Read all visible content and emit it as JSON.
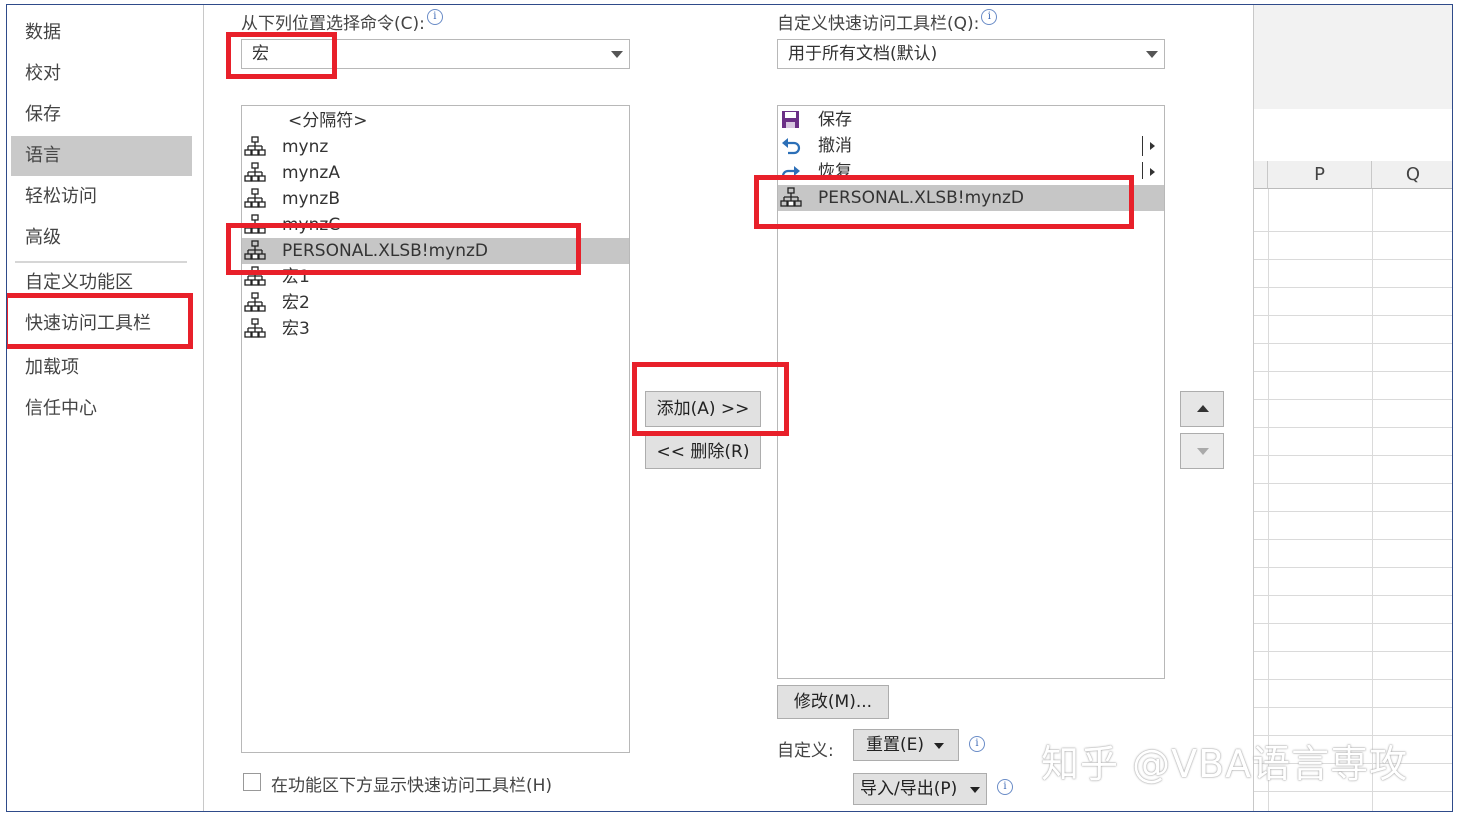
{
  "nav": {
    "items": [
      {
        "label": "数据"
      },
      {
        "label": "校对"
      },
      {
        "label": "保存"
      },
      {
        "label": "语言"
      },
      {
        "label": "轻松访问"
      },
      {
        "label": "高级"
      },
      {
        "label": "自定义功能区"
      },
      {
        "label": "快速访问工具栏"
      },
      {
        "label": "加载项"
      },
      {
        "label": "信任中心"
      }
    ],
    "selected": "语言"
  },
  "left_panel": {
    "choose_label": "从下列位置选择命令(C):",
    "choose_value": "宏",
    "items": [
      {
        "label": "<分隔符>",
        "icon": "separator"
      },
      {
        "label": "mynz",
        "icon": "macro-icon"
      },
      {
        "label": "mynzA",
        "icon": "macro-icon"
      },
      {
        "label": "mynzB",
        "icon": "macro-icon"
      },
      {
        "label": "mynzC",
        "icon": "macro-icon"
      },
      {
        "label": "PERSONAL.XLSB!mynzD",
        "icon": "macro-icon"
      },
      {
        "label": "宏1",
        "icon": "macro-icon"
      },
      {
        "label": "宏2",
        "icon": "macro-icon"
      },
      {
        "label": "宏3",
        "icon": "macro-icon"
      }
    ],
    "selected_item": "PERSONAL.XLSB!mynzD",
    "show_below_label": "在功能区下方显示快速访问工具栏(H)"
  },
  "middle": {
    "add_label": "添加(A) >>",
    "remove_label": "<< 删除(R)"
  },
  "right_panel": {
    "customize_label": "自定义快速访问工具栏(Q):",
    "customize_value": "用于所有文档(默认)",
    "items": [
      {
        "label": "保存",
        "icon": "save-icon"
      },
      {
        "label": "撤消",
        "icon": "undo-icon"
      },
      {
        "label": "恢复",
        "icon": "redo-icon"
      },
      {
        "label": "PERSONAL.XLSB!mynzD",
        "icon": "macro-icon"
      }
    ],
    "modify_label": "修改(M)...",
    "custom_label": "自定义:",
    "reset_label": "重置(E)",
    "import_export_label": "导入/导出(P)"
  },
  "sheet": {
    "columns": [
      "P",
      "Q"
    ]
  },
  "watermark": "知乎 @VBA语言専攻",
  "colors": {
    "highlight": "#e8202a",
    "selection": "#c6c6c6",
    "nav_selected": "#c9c9c9"
  }
}
